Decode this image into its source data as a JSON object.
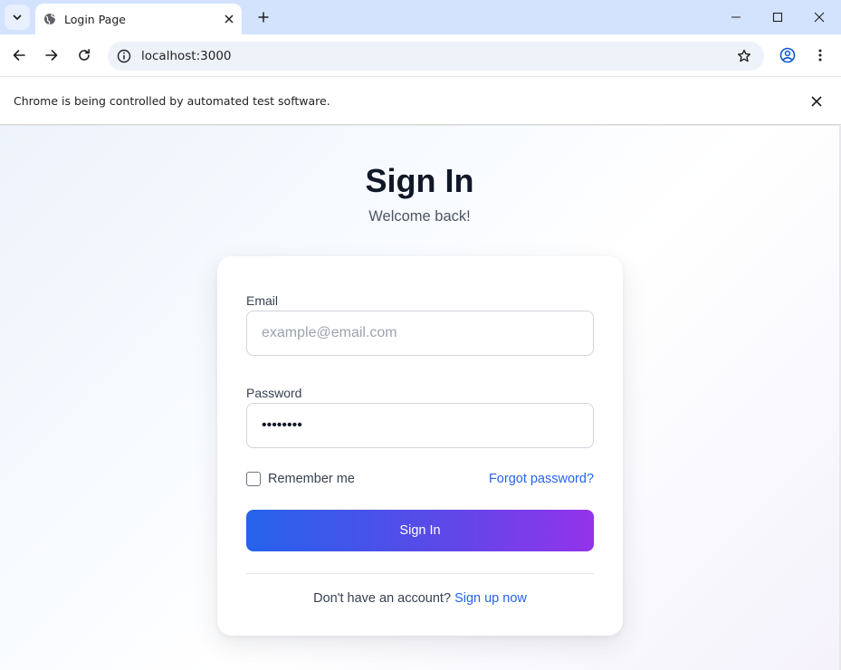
{
  "browser": {
    "tab_title": "Login Page",
    "url": "localhost:3000",
    "infobar_text": "Chrome is being controlled by automated test software."
  },
  "page": {
    "title": "Sign In",
    "subtitle": "Welcome back!"
  },
  "form": {
    "email_label": "Email",
    "email_placeholder": "example@email.com",
    "password_label": "Password",
    "password_value": "••••••••",
    "remember_label": "Remember me",
    "remember_checked": false,
    "forgot_label": "Forgot password?",
    "submit_label": "Sign In",
    "footer_text": "Don't have an account?",
    "signup_label": "Sign up now"
  },
  "colors": {
    "accent": "#2563eb",
    "button_gradient_start": "#2563eb",
    "button_gradient_end": "#9333ea",
    "tabstrip": "#d3e3fd"
  },
  "icons": [
    "tab-search-icon",
    "globe-icon",
    "close-icon",
    "plus-icon",
    "minimize-icon",
    "maximize-icon",
    "back-icon",
    "forward-icon",
    "reload-icon",
    "info-icon",
    "star-icon",
    "profile-icon",
    "menu-icon"
  ]
}
